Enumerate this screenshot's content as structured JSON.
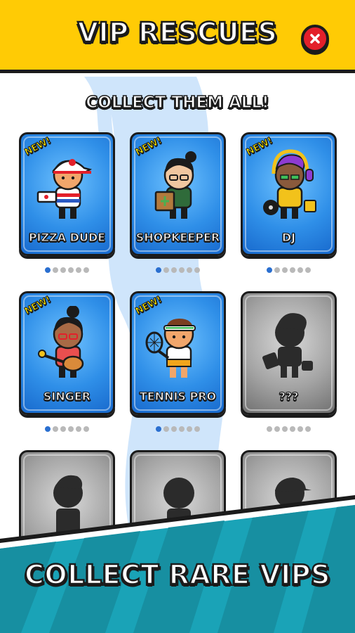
{
  "header": {
    "title": "VIP RESCUES",
    "close_icon": "close-x-icon"
  },
  "subtitle": "COLLECT THEM ALL!",
  "cards": [
    {
      "label": "PIZZA DUDE",
      "badge": "NEW!",
      "state": "unlocked",
      "dots_total": 6,
      "dots_active": 1
    },
    {
      "label": "SHOPKEEPER",
      "badge": "NEW!",
      "state": "unlocked",
      "dots_total": 6,
      "dots_active": 1
    },
    {
      "label": "DJ",
      "badge": "NEW!",
      "state": "unlocked",
      "dots_total": 6,
      "dots_active": 1
    },
    {
      "label": "SINGER",
      "badge": "NEW!",
      "state": "unlocked",
      "dots_total": 6,
      "dots_active": 1
    },
    {
      "label": "TENNIS PRO",
      "badge": "NEW!",
      "state": "unlocked",
      "dots_total": 6,
      "dots_active": 1
    },
    {
      "label": "???",
      "badge": "",
      "state": "locked",
      "dots_total": 6,
      "dots_active": 0
    },
    {
      "label": "",
      "badge": "",
      "state": "locked"
    },
    {
      "label": "",
      "badge": "",
      "state": "locked"
    },
    {
      "label": "",
      "badge": "",
      "state": "locked"
    }
  ],
  "banner": {
    "text": "COLLECT RARE VIPS"
  },
  "colors": {
    "header": "#ffcb05",
    "card_blue": "#2f8fe8",
    "close": "#e3202a",
    "banner": "#1a9fb3",
    "dot_active": "#2a6fd0"
  }
}
